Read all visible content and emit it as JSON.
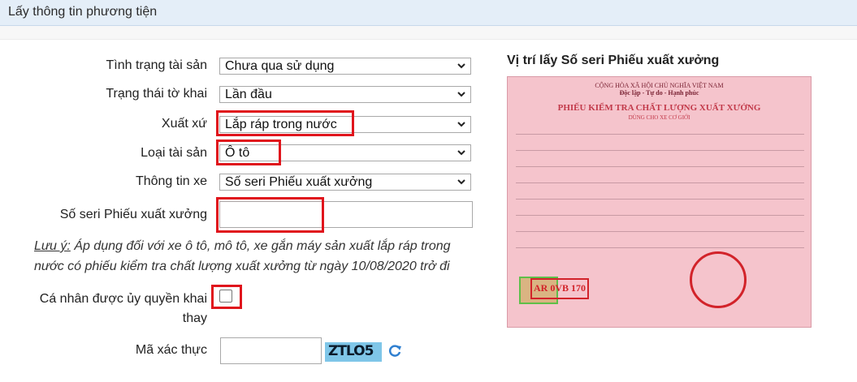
{
  "header": {
    "title": "Lấy thông tin phương tiện"
  },
  "form": {
    "tinh_trang": {
      "label": "Tình trạng tài sản",
      "value": "Chưa qua sử dụng"
    },
    "trang_thai": {
      "label": "Trạng thái tờ khai",
      "value": "Lần đầu"
    },
    "xuat_xu": {
      "label": "Xuất xứ",
      "value": "Lắp ráp trong nước"
    },
    "loai_tai_san": {
      "label": "Loại tài sản",
      "value": "Ô tô"
    },
    "thong_tin_xe": {
      "label": "Thông tin xe",
      "value": "Số seri Phiếu xuất xưởng"
    },
    "so_seri": {
      "label": "Số seri Phiếu xuất xưởng",
      "value": ""
    },
    "note": {
      "prefix": "Lưu ý:",
      "line1": " Áp dụng đối với xe ô tô, mô tô, xe gắn máy sản xuất lắp ráp trong",
      "line2": "nước có phiếu kiểm tra chất lượng xuất xưởng từ ngày 10/08/2020 trở đi"
    },
    "uy_quyen": {
      "label_line1": "Cá nhân được ủy quyền khai",
      "label_line2": "thay",
      "checked": false
    },
    "ma_xac_thuc": {
      "label": "Mã xác thực",
      "value": "",
      "captcha_text": "ZTLO5"
    }
  },
  "right_panel": {
    "title": "Vị trí lấy Số seri Phiếu xuất xưởng",
    "certificate": {
      "header1": "CỘNG HÒA XÃ HỘI CHỦ NGHĨA VIỆT NAM",
      "header2": "Độc lập - Tự do - Hạnh phúc",
      "title": "PHIẾU KIỂM TRA CHẤT LƯỢNG XUẤT XƯỞNG",
      "subtitle": "DÙNG CHO XE CƠ GIỚI",
      "stamp_text": "AR 0VB 170"
    }
  },
  "colors": {
    "highlight": "#e0141c",
    "header_bg": "#e4eef8"
  },
  "icons": {
    "dropdown": "chevron-down-icon",
    "refresh": "refresh-icon"
  }
}
